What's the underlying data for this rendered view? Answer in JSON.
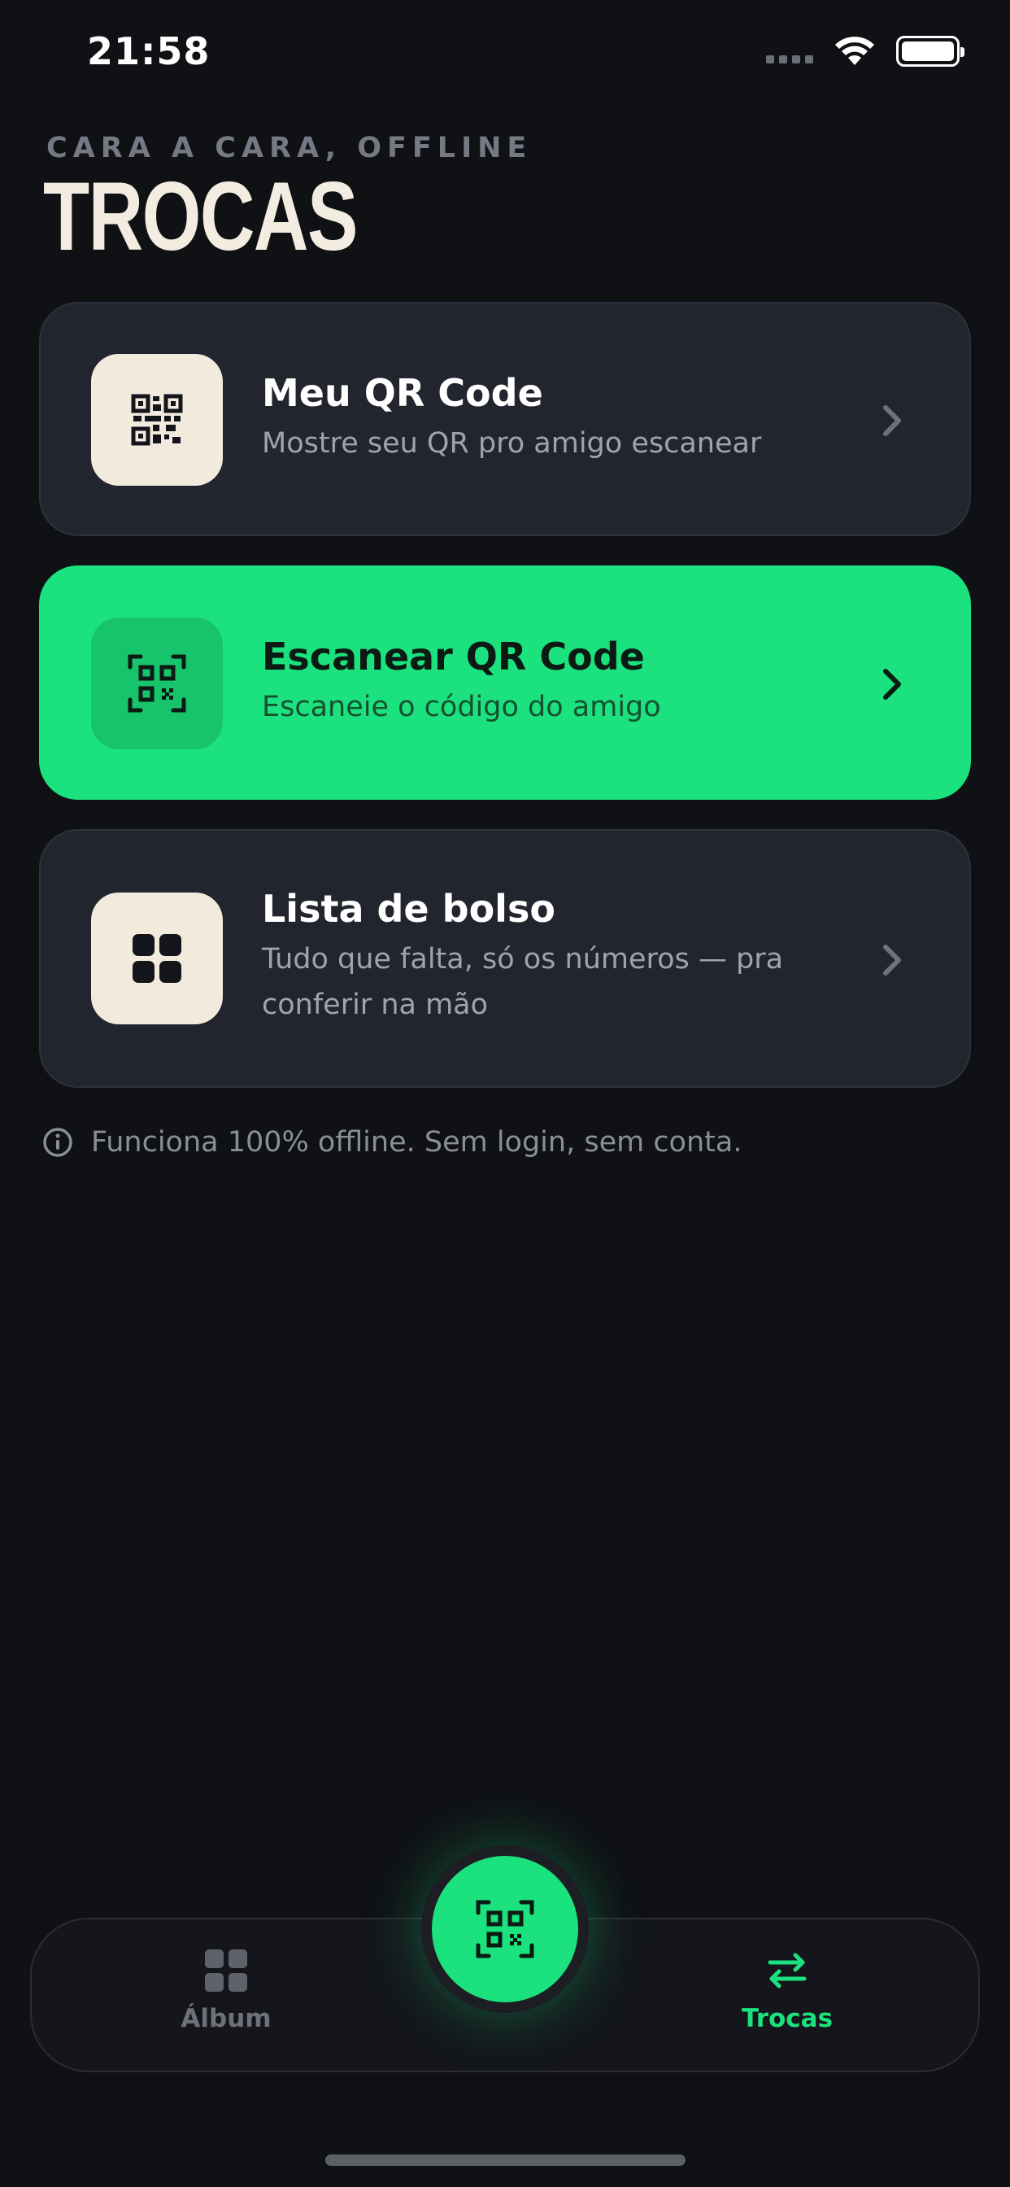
{
  "status_bar": {
    "time": "21:58"
  },
  "header": {
    "eyebrow": "CARA A CARA, OFFLINE",
    "title": "TROCAS"
  },
  "cards": [
    {
      "title": "Meu QR Code",
      "subtitle": "Mostre seu QR pro amigo escanear",
      "icon": "qr-code-icon"
    },
    {
      "title": "Escanear QR Code",
      "subtitle": "Escaneie o código do amigo",
      "icon": "qr-scan-icon"
    },
    {
      "title": "Lista de bolso",
      "subtitle": "Tudo que falta, só os números — pra conferir na mão",
      "icon": "grid-icon"
    }
  ],
  "info": {
    "text": "Funciona 100% offline. Sem login, sem conta.",
    "icon": "info-icon"
  },
  "tabbar": {
    "tabs": [
      {
        "label": "Álbum",
        "icon": "grid-icon",
        "active": false
      },
      {
        "label": "Trocas",
        "icon": "swap-arrows-icon",
        "active": true
      }
    ],
    "fab_icon": "qr-scan-icon"
  },
  "colors": {
    "background": "#101115",
    "card": "#22252e",
    "accent": "#1be27e",
    "cream": "#f1eadd",
    "muted": "#8a8e97"
  }
}
